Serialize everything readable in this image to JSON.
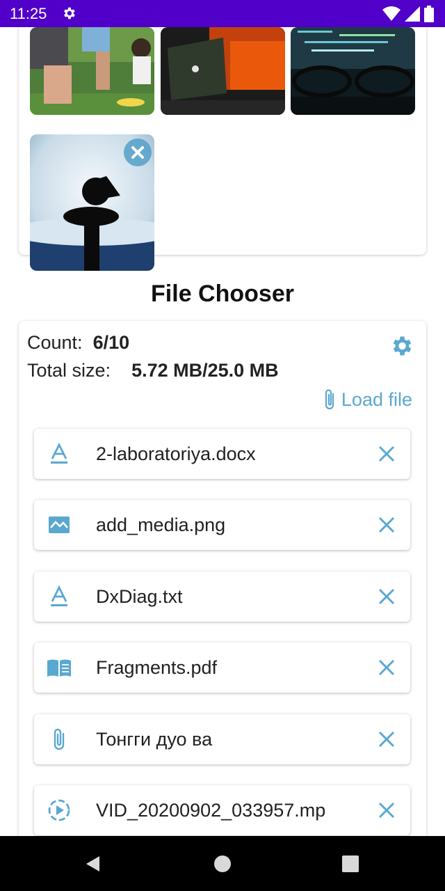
{
  "status_bar": {
    "time": "11:25",
    "icons": [
      "settings-icon",
      "wifi-icon",
      "signal-icon",
      "battery-icon"
    ]
  },
  "media": {
    "thumbnails": [
      {
        "name": "photo-kids-garden"
      },
      {
        "name": "photo-laptop"
      },
      {
        "name": "photo-monitor-glasses"
      },
      {
        "name": "photo-silhouette-moon",
        "removable": true
      }
    ]
  },
  "file_chooser": {
    "title": "File Chooser",
    "count_label": "Count:",
    "count_value": "6/10",
    "size_label": "Total size:",
    "size_value": "5.72 MB/25.0 MB",
    "load_label": "Load file",
    "files": [
      {
        "name": "2-laboratoriya.docx",
        "icon": "document-text-icon"
      },
      {
        "name": "add_media.png",
        "icon": "image-icon"
      },
      {
        "name": "DxDiag.txt",
        "icon": "document-text-icon"
      },
      {
        "name": "Fragments.pdf",
        "icon": "book-icon"
      },
      {
        "name": "Тонгги дуо ва",
        "icon": "paperclip-icon"
      },
      {
        "name": "VID_20200902_033957.mp",
        "icon": "video-play-icon"
      }
    ]
  },
  "colors": {
    "status_bar": "#5000c8",
    "accent": "#5aa8d0",
    "nav_bar": "#000000"
  }
}
